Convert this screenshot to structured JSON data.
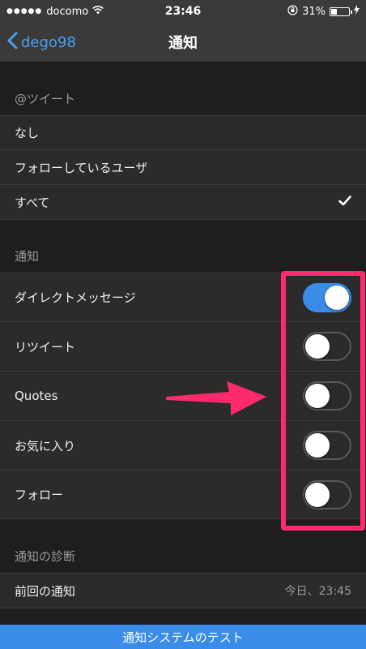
{
  "status": {
    "carrier": "docomo",
    "time": "23:46",
    "battery": "31%",
    "battery_level": 0.31
  },
  "nav": {
    "back_label": "dego98",
    "title": "通知"
  },
  "tweet_section": {
    "header": "@ツイート",
    "options": [
      {
        "label": "なし"
      },
      {
        "label": "フォローしているユーザ"
      },
      {
        "label": "すべて",
        "selected": true
      }
    ]
  },
  "notify_section": {
    "header": "通知",
    "items": [
      {
        "label": "ダイレクトメッセージ",
        "on": true
      },
      {
        "label": "リツイート",
        "on": false
      },
      {
        "label": "Quotes",
        "on": false
      },
      {
        "label": "お気に入り",
        "on": false
      },
      {
        "label": "フォロー",
        "on": false
      }
    ]
  },
  "diag_section": {
    "header": "通知の診断",
    "last_label": "前回の通知",
    "last_value": "今日、23:45"
  },
  "test_button": "通知システムのテスト",
  "colors": {
    "accent": "#3a8ce8",
    "highlight": "#ff2a6e"
  }
}
